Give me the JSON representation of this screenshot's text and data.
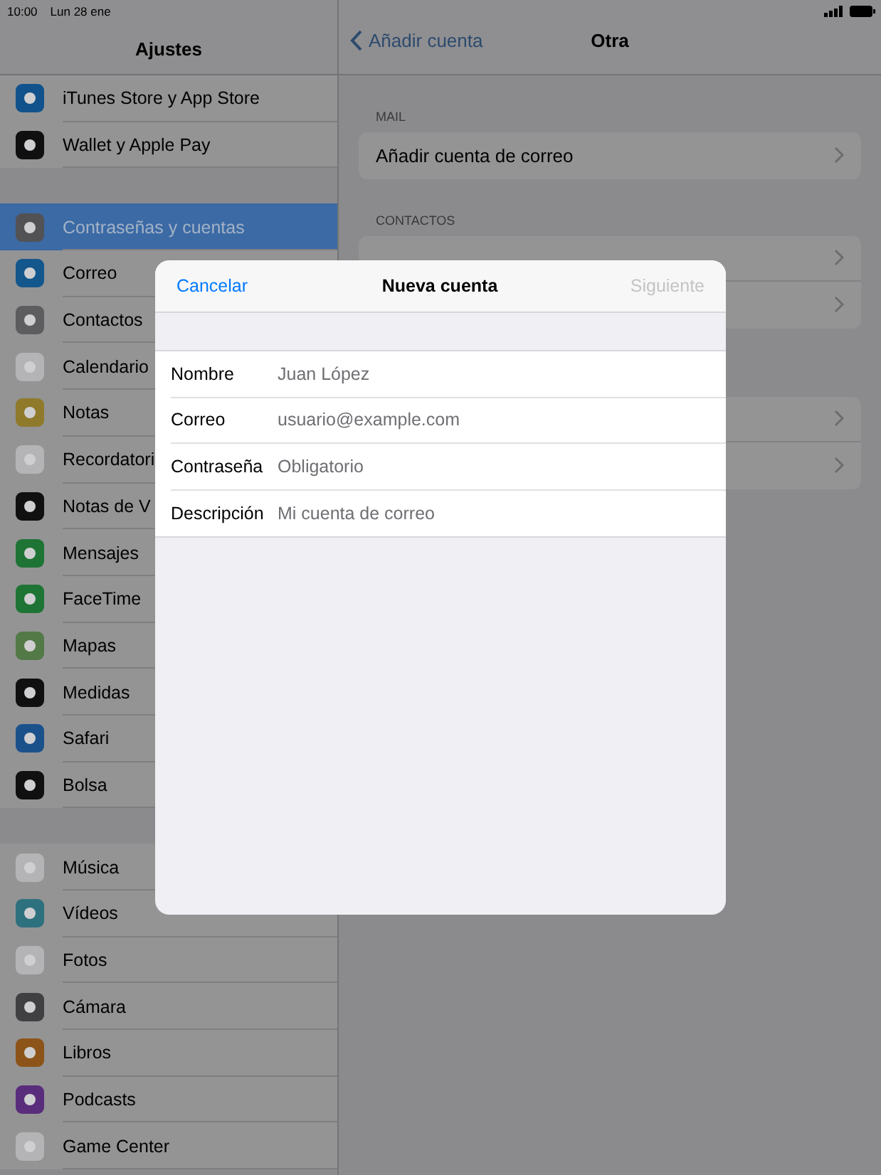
{
  "status_bar": {
    "time": "10:00",
    "date": "Lun 28 ene"
  },
  "sidebar": {
    "title": "Ajustes",
    "groups": [
      [
        {
          "label": "iTunes Store y App Store",
          "color": "#11528c",
          "selected": false
        },
        {
          "label": "Wallet y Apple Pay",
          "color": "#101011",
          "selected": false
        }
      ],
      [
        {
          "label": "Contraseñas y cuentas",
          "color": "#525255",
          "selected": true
        },
        {
          "label": "Correo",
          "color": "#13578d",
          "selected": false
        },
        {
          "label": "Contactos",
          "color": "#5d5d60",
          "selected": false
        },
        {
          "label": "Calendario",
          "color": "#b4b4b6",
          "selected": false
        },
        {
          "label": "Notas",
          "color": "#8f7a2b",
          "selected": false
        },
        {
          "label": "Recordatori",
          "color": "#b4b4b6",
          "selected": false
        },
        {
          "label": "Notas de V",
          "color": "#101011",
          "selected": false
        },
        {
          "label": "Mensajes",
          "color": "#1e7434",
          "selected": false
        },
        {
          "label": "FaceTime",
          "color": "#1e7434",
          "selected": false
        },
        {
          "label": "Mapas",
          "color": "#537947",
          "selected": false
        },
        {
          "label": "Medidas",
          "color": "#101011",
          "selected": false
        },
        {
          "label": "Safari",
          "color": "#1b518b",
          "selected": false
        },
        {
          "label": "Bolsa",
          "color": "#101011",
          "selected": false
        }
      ],
      [
        {
          "label": "Música",
          "color": "#b4b4b6",
          "selected": false
        },
        {
          "label": "Vídeos",
          "color": "#2e717e",
          "selected": false
        },
        {
          "label": "Fotos",
          "color": "#b4b4b6",
          "selected": false
        },
        {
          "label": "Cámara",
          "color": "#404043",
          "selected": false
        },
        {
          "label": "Libros",
          "color": "#8c5419",
          "selected": false
        },
        {
          "label": "Podcasts",
          "color": "#5a2d7c",
          "selected": false
        },
        {
          "label": "Game Center",
          "color": "#b4b4b6",
          "selected": false
        }
      ]
    ]
  },
  "detail": {
    "back": "Añadir cuenta",
    "title": "Otra",
    "sections": [
      {
        "header": "MAIL",
        "rows": [
          {
            "label": "Añadir cuenta de correo"
          }
        ]
      },
      {
        "header": "CONTACTOS",
        "rows": [
          {},
          {}
        ]
      },
      {
        "rows": [
          {},
          {}
        ]
      }
    ]
  },
  "modal": {
    "cancel": "Cancelar",
    "title": "Nueva cuenta",
    "next": {
      "label": "Siguiente",
      "disabled": true
    },
    "fields": [
      {
        "label": "Nombre",
        "placeholder": "Juan López"
      },
      {
        "label": "Correo",
        "placeholder": "usuario@example.com"
      },
      {
        "label": "Contraseña",
        "placeholder": "Obligatorio"
      },
      {
        "label": "Descripción",
        "placeholder": "Mi cuenta de correo"
      }
    ]
  }
}
